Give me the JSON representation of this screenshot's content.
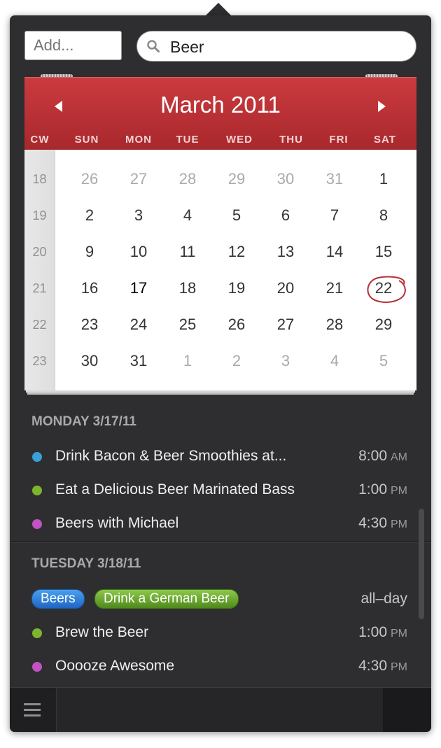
{
  "add_field": {
    "placeholder": "Add..."
  },
  "search": {
    "value": "Beer"
  },
  "calendar": {
    "month_title": "March 2011",
    "dow_labels": [
      "CW",
      "SUN",
      "MON",
      "TUE",
      "WED",
      "THU",
      "FRI",
      "SAT"
    ],
    "weeks": [
      {
        "cw": "18",
        "days": [
          "26",
          "27",
          "28",
          "29",
          "30",
          "31",
          "1"
        ]
      },
      {
        "cw": "19",
        "days": [
          "2",
          "3",
          "4",
          "5",
          "6",
          "7",
          "8"
        ]
      },
      {
        "cw": "20",
        "days": [
          "9",
          "10",
          "11",
          "12",
          "13",
          "14",
          "15"
        ]
      },
      {
        "cw": "21",
        "days": [
          "16",
          "17",
          "18",
          "19",
          "20",
          "21",
          "22"
        ]
      },
      {
        "cw": "22",
        "days": [
          "23",
          "24",
          "25",
          "26",
          "27",
          "28",
          "29"
        ]
      },
      {
        "cw": "23",
        "days": [
          "30",
          "31",
          "1",
          "2",
          "3",
          "4",
          "5"
        ]
      }
    ],
    "today": "17",
    "selected": "22"
  },
  "sections": [
    {
      "title": "MONDAY 3/17/11",
      "events": [
        {
          "title": "Drink Bacon & Beer Smoothies at...",
          "time": "8:00",
          "ampm": "AM",
          "color": "#3aa0d8"
        },
        {
          "title": "Eat a Delicious Beer Marinated Bass",
          "time": "1:00",
          "ampm": "PM",
          "color": "#7eb52e"
        },
        {
          "title": "Beers with Michael",
          "time": "4:30",
          "ampm": "PM",
          "color": "#c252c4"
        }
      ]
    },
    {
      "title": "TUESDAY 3/18/11",
      "allday_label": "all–day",
      "allday_pills": [
        "Beers",
        "Drink a German Beer"
      ],
      "events": [
        {
          "title": "Brew the Beer",
          "time": "1:00",
          "ampm": "PM",
          "color": "#7eb52e"
        },
        {
          "title": "Ooooze Awesome",
          "time": "4:30",
          "ampm": "PM",
          "color": "#c252c4"
        }
      ]
    }
  ],
  "colors": {
    "header_red": "#b52f33",
    "panel": "#2e2e30"
  }
}
